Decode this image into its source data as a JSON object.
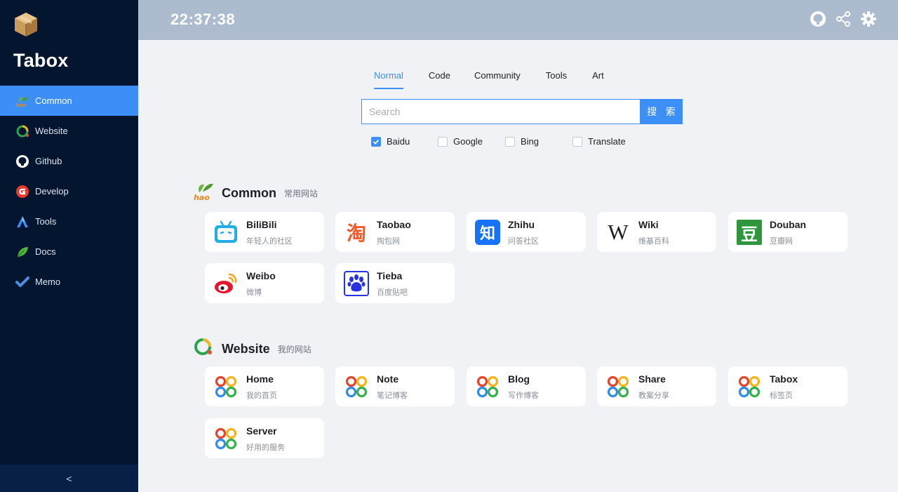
{
  "app": {
    "brand": "Tabox",
    "clock": "22:37:38"
  },
  "colors": {
    "sidebar": "#041530",
    "accent": "#3b8ff7",
    "header": "#adbbcf",
    "page_bg": "#f1f2f5"
  },
  "header_icons": [
    "github-icon",
    "share-icon",
    "gear-icon"
  ],
  "sidebar": {
    "items": [
      {
        "label": "Common",
        "icon": "hao-icon",
        "active": true
      },
      {
        "label": "Website",
        "icon": "ring-icon",
        "active": false
      },
      {
        "label": "Github",
        "icon": "github-icon",
        "active": false
      },
      {
        "label": "Develop",
        "icon": "develop-icon",
        "active": false
      },
      {
        "label": "Tools",
        "icon": "tools-icon",
        "active": false
      },
      {
        "label": "Docs",
        "icon": "leaf-icon",
        "active": false
      },
      {
        "label": "Memo",
        "icon": "check-icon",
        "active": false
      }
    ],
    "collapse_glyph": "<"
  },
  "tabs": [
    {
      "label": "Normal",
      "active": true
    },
    {
      "label": "Code",
      "active": false
    },
    {
      "label": "Community",
      "active": false
    },
    {
      "label": "Tools",
      "active": false
    },
    {
      "label": "Art",
      "active": false
    }
  ],
  "search": {
    "placeholder": "Search",
    "value": "",
    "button": "搜 索"
  },
  "engines": [
    {
      "label": "Baidu",
      "checked": true
    },
    {
      "label": "Google",
      "checked": false
    },
    {
      "label": "Bing",
      "checked": false
    },
    {
      "label": "Translate",
      "checked": false
    }
  ],
  "sections": [
    {
      "title": "Common",
      "subtitle": "常用网站",
      "icon": "hao-icon",
      "cards": [
        {
          "title": "BiliBili",
          "sub": "年轻人的社区",
          "icon": "bilibili-icon"
        },
        {
          "title": "Taobao",
          "sub": "掏包网",
          "icon": "taobao-icon"
        },
        {
          "title": "Zhihu",
          "sub": "问答社区",
          "icon": "zhihu-icon"
        },
        {
          "title": "Wiki",
          "sub": "维基百科",
          "icon": "wikipedia-icon"
        },
        {
          "title": "Douban",
          "sub": "豆瓣网",
          "icon": "douban-icon"
        },
        {
          "title": "Weibo",
          "sub": "微博",
          "icon": "weibo-icon"
        },
        {
          "title": "Tieba",
          "sub": "百度贴吧",
          "icon": "tieba-icon"
        }
      ]
    },
    {
      "title": "Website",
      "subtitle": "我的网站",
      "icon": "ring-icon",
      "cards": [
        {
          "title": "Home",
          "sub": "我的首页",
          "icon": "clover-icon"
        },
        {
          "title": "Note",
          "sub": "笔记博客",
          "icon": "clover-icon"
        },
        {
          "title": "Blog",
          "sub": "写作博客",
          "icon": "clover-icon"
        },
        {
          "title": "Share",
          "sub": "教案分享",
          "icon": "clover-icon"
        },
        {
          "title": "Tabox",
          "sub": "标签页",
          "icon": "clover-icon"
        },
        {
          "title": "Server",
          "sub": "好用的服务",
          "icon": "clover-icon"
        }
      ]
    }
  ],
  "glyphs": {
    "taobao": "淘",
    "zhihu": "知",
    "wiki": "W",
    "douban": "豆",
    "hao": "hao"
  }
}
